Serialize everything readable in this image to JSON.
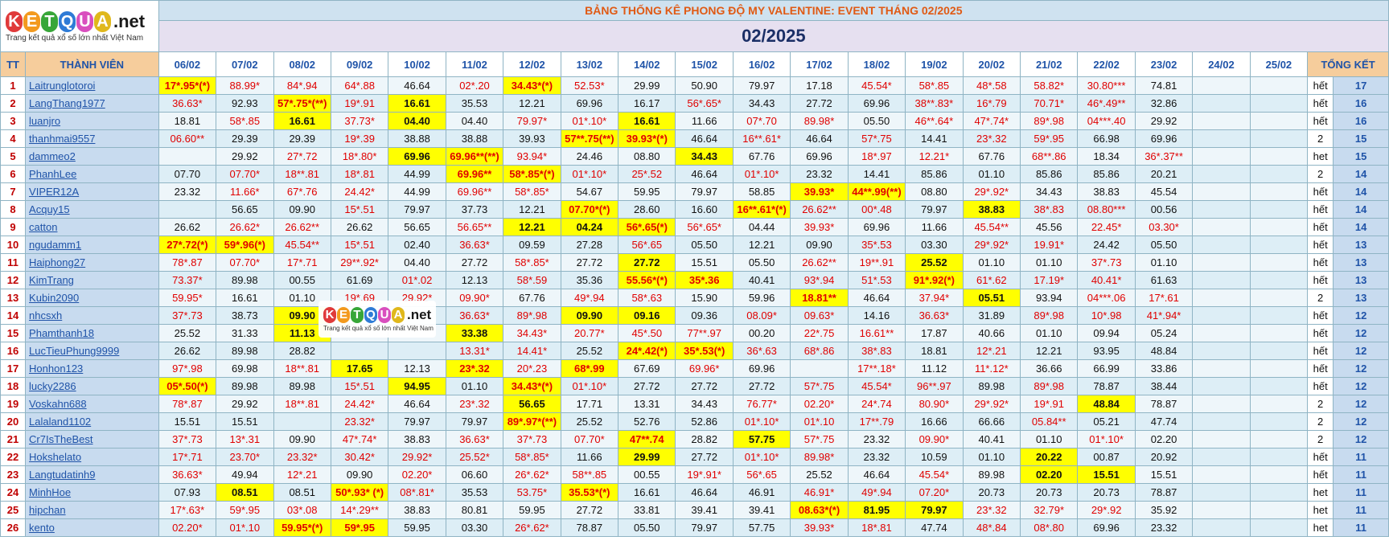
{
  "title": "BẢNG THỐNG KÊ PHONG ĐỘ MY VALENTINE: EVENT THÁNG 02/2025",
  "month": "02/2025",
  "logo": {
    "letters": [
      "K",
      "E",
      "T",
      "Q",
      "U",
      "A"
    ],
    "suffix": ".net",
    "tagline": "Trang kết quả xổ số lớn nhất Việt Nam",
    "colors": [
      "#e03a3a",
      "#f39a1e",
      "#37a638",
      "#2e7bd6",
      "#d94fbe",
      "#e0b81c"
    ]
  },
  "headers": {
    "tt": "TT",
    "member": "THÀNH VIÊN",
    "dates": [
      "06/02",
      "07/02",
      "08/02",
      "09/02",
      "10/02",
      "11/02",
      "12/02",
      "13/02",
      "14/02",
      "15/02",
      "16/02",
      "17/02",
      "18/02",
      "19/02",
      "20/02",
      "21/02",
      "22/02",
      "23/02",
      "24/02",
      "25/02"
    ],
    "total": "TỔNG KẾT"
  },
  "rows": [
    {
      "tt": "1",
      "name": "Laitrunglotoroi",
      "status": "hết",
      "total": "17",
      "cells": [
        "17*.95*(*)",
        "88.99*",
        "84*.94",
        "64*.88",
        "46.64",
        "02*.20",
        "34.43*(*)",
        "52.53*",
        "29.99",
        "50.90",
        "79.97",
        "17.18",
        "45.54*",
        "58*.85",
        "48*.58",
        "58.82*",
        "30.80***",
        "74.81",
        "",
        ""
      ]
    },
    {
      "tt": "2",
      "name": "LangThang1977",
      "status": "hết",
      "total": "16",
      "cells": [
        "36.63*",
        "92.93",
        "57*.75*(**)",
        "19*.91",
        "16.61",
        "35.53",
        "12.21",
        "69.96",
        "16.17",
        "56*.65*",
        "34.43",
        "27.72",
        "69.96",
        "38**.83*",
        "16*.79",
        "70.71*",
        "46*.49**",
        "32.86",
        "",
        ""
      ]
    },
    {
      "tt": "3",
      "name": "luanjro",
      "status": "hết",
      "total": "16",
      "cells": [
        "18.81",
        "58*.85",
        "16.61",
        "37.73*",
        "04.40",
        "04.40",
        "79.97*",
        "01*.10*",
        "16.61",
        "11.66",
        "07*.70",
        "89.98*",
        "05.50",
        "46**.64*",
        "47*.74*",
        "89*.98",
        "04***.40",
        "29.92",
        "",
        ""
      ]
    },
    {
      "tt": "4",
      "name": "thanhmai9557",
      "status": "2",
      "total": "15",
      "cells": [
        "06.60**",
        "29.39",
        "29.39",
        "19*.39",
        "38.88",
        "38.88",
        "39.93",
        "57**.75(**)",
        "39.93*(*)",
        "46.64",
        "16**.61*",
        "46.64",
        "57*.75",
        "14.41",
        "23*.32",
        "59*.95",
        "66.98",
        "69.96",
        "",
        ""
      ]
    },
    {
      "tt": "5",
      "name": "dammeo2",
      "status": "het",
      "total": "15",
      "cells": [
        "",
        "29.92",
        "27*.72",
        "18*.80*",
        "69.96",
        "69.96**(**)",
        "93.94*",
        "24.46",
        "08.80",
        "34.43",
        "67.76",
        "69.96",
        "18*.97",
        "12.21*",
        "67.76",
        "68**.86",
        "18.34",
        "36*.37**",
        "",
        ""
      ]
    },
    {
      "tt": "6",
      "name": "PhanhLee",
      "status": "2",
      "total": "14",
      "cells": [
        "07.70",
        "07.70*",
        "18**.81",
        "18*.81",
        "44.99",
        "69.96**",
        "58*.85*(*)",
        "01*.10*",
        "25*.52",
        "46.64",
        "01*.10*",
        "23.32",
        "14.41",
        "85.86",
        "01.10",
        "85.86",
        "85.86",
        "20.21",
        "",
        ""
      ]
    },
    {
      "tt": "7",
      "name": "VIPER12A",
      "status": "hết",
      "total": "14",
      "cells": [
        "23.32",
        "11.66*",
        "67*.76",
        "24.42*",
        "44.99",
        "69.96**",
        "58*.85*",
        "54.67",
        "59.95",
        "79.97",
        "58.85",
        "39.93*",
        "44**.99(**)",
        "08.80",
        "29*.92*",
        "34.43",
        "38.83",
        "45.54",
        "",
        ""
      ]
    },
    {
      "tt": "8",
      "name": "Acquy15",
      "status": "hết",
      "total": "14",
      "cells": [
        "",
        "56.65",
        "09.90",
        "15*.51",
        "79.97",
        "37.73",
        "12.21",
        "07.70*(*)",
        "28.60",
        "16.60",
        "16**.61*(*)",
        "26.62**",
        "00*.48",
        "79.97",
        "38.83",
        "38*.83",
        "08.80***",
        "00.56",
        "",
        ""
      ]
    },
    {
      "tt": "9",
      "name": "catton",
      "status": "hết",
      "total": "14",
      "cells": [
        "26.62",
        "26.62*",
        "26.62**",
        "26.62",
        "56.65",
        "56.65**",
        "12.21",
        "04.24",
        "56*.65(*)",
        "56*.65*",
        "04.44",
        "39.93*",
        "69.96",
        "11.66",
        "45.54**",
        "45.56",
        "22.45*",
        "03.30*",
        "",
        ""
      ]
    },
    {
      "tt": "10",
      "name": "ngudamm1",
      "status": "hết",
      "total": "13",
      "cells": [
        "27*.72(*)",
        "59*.96(*)",
        "45.54**",
        "15*.51",
        "02.40",
        "36.63*",
        "09.59",
        "27.28",
        "56*.65",
        "05.50",
        "12.21",
        "09.90",
        "35*.53",
        "03.30",
        "29*.92*",
        "19.91*",
        "24.42",
        "05.50",
        "",
        ""
      ]
    },
    {
      "tt": "11",
      "name": "Haiphong27",
      "status": "hết",
      "total": "13",
      "cells": [
        "78*.87",
        "07.70*",
        "17*.71",
        "29**.92*",
        "04.40",
        "27.72",
        "58*.85*",
        "27.72",
        "27.72",
        "15.51",
        "05.50",
        "26.62**",
        "19**.91",
        "25.52",
        "01.10",
        "01.10",
        "37*.73",
        "01.10",
        "",
        ""
      ]
    },
    {
      "tt": "12",
      "name": "KimTrang",
      "status": "hết",
      "total": "13",
      "cells": [
        "73.37*",
        "89.98",
        "00.55",
        "61.69",
        "01*.02",
        "12.13",
        "58*.59",
        "35.36",
        "55.56*(*)",
        "35*.36",
        "40.41",
        "93*.94",
        "51*.53",
        "91*.92(*)",
        "61*.62",
        "17.19*",
        "40.41*",
        "61.63",
        "",
        ""
      ]
    },
    {
      "tt": "13",
      "name": "Kubin2090",
      "status": "2",
      "total": "13",
      "cells": [
        "59.95*",
        "16.61",
        "01.10",
        "19*.69",
        "29.92*",
        "09.90*",
        "67.76",
        "49*.94",
        "58*.63",
        "15.90",
        "59.96",
        "18.81**",
        "46.64",
        "37.94*",
        "05.51",
        "93.94",
        "04***.06",
        "17*.61",
        "",
        ""
      ]
    },
    {
      "tt": "14",
      "name": "nhcsxh",
      "status": "hết",
      "total": "12",
      "cells": [
        "37*.73",
        "38.73",
        "09.90",
        "",
        "",
        "36.63*",
        "89*.98",
        "09.90",
        "09.16",
        "09.36",
        "08.09*",
        "09.63*",
        "14.16",
        "36.63*",
        "31.89",
        "89*.98",
        "10*.98",
        "41*.94*",
        "",
        ""
      ]
    },
    {
      "tt": "15",
      "name": "Phamthanh18",
      "status": "hết",
      "total": "12",
      "cells": [
        "25.52",
        "31.33",
        "11.13",
        "",
        "",
        "33.38",
        "34.43*",
        "20.77*",
        "45*.50",
        "77**.97",
        "00.20",
        "22*.75",
        "16.61**",
        "17.87",
        "40.66",
        "01.10",
        "09.94",
        "05.24",
        "",
        ""
      ]
    },
    {
      "tt": "16",
      "name": "LucTieuPhung9999",
      "status": "hết",
      "total": "12",
      "cells": [
        "26.62",
        "89.98",
        "28.82",
        "",
        "",
        "13.31*",
        "14.41*",
        "25.52",
        "24*.42(*)",
        "35*.53(*)",
        "36*.63",
        "68*.86",
        "38*.83",
        "18.81",
        "12*.21",
        "12.21",
        "93.95",
        "48.84",
        "",
        ""
      ]
    },
    {
      "tt": "17",
      "name": "Honhon123",
      "status": "hết",
      "total": "12",
      "cells": [
        "97*.98",
        "69.98",
        "18**.81",
        "17.65",
        "12.13",
        "23*.32",
        "20*.23",
        "68*.99",
        "67.69",
        "69.96*",
        "69.96",
        "",
        "17**.18*",
        "11.12",
        "11*.12*",
        "36.66",
        "66.99",
        "33.86",
        "",
        ""
      ]
    },
    {
      "tt": "18",
      "name": "lucky2286",
      "status": "hết",
      "total": "12",
      "cells": [
        "05*.50(*)",
        "89.98",
        "89.98",
        "15*.51",
        "94.95",
        "01.10",
        "34.43*(*)",
        "01*.10*",
        "27.72",
        "27.72",
        "27.72",
        "57*.75",
        "45.54*",
        "96**.97",
        "89.98",
        "89*.98",
        "78.87",
        "38.44",
        "",
        ""
      ]
    },
    {
      "tt": "19",
      "name": "Voskahn688",
      "status": "2",
      "total": "12",
      "cells": [
        "78*.87",
        "29.92",
        "18**.81",
        "24.42*",
        "46.64",
        "23*.32",
        "56.65",
        "17.71",
        "13.31",
        "34.43",
        "76.77*",
        "02.20*",
        "24*.74",
        "80.90*",
        "29*.92*",
        "19*.91",
        "48.84",
        "78.87",
        "",
        ""
      ]
    },
    {
      "tt": "20",
      "name": "Lalaland1102",
      "status": "2",
      "total": "12",
      "cells": [
        "15.51",
        "15.51",
        "",
        "23.32*",
        "79.97",
        "79.97",
        "89*.97*(**)",
        "25.52",
        "52.76",
        "52.86",
        "01*.10*",
        "01*.10",
        "17**.79",
        "16.66",
        "66.66",
        "05.84**",
        "05.21",
        "47.74",
        "",
        ""
      ]
    },
    {
      "tt": "21",
      "name": "Cr7IsTheBest",
      "status": "2",
      "total": "12",
      "cells": [
        "37*.73",
        "13*.31",
        "09.90",
        "47*.74*",
        "38.83",
        "36.63*",
        "37*.73",
        "07.70*",
        "47**.74",
        "28.82",
        "57.75",
        "57*.75",
        "23.32",
        "09.90*",
        "40.41",
        "01.10",
        "01*.10*",
        "02.20",
        "",
        ""
      ]
    },
    {
      "tt": "22",
      "name": "Hokshelato",
      "status": "hết",
      "total": "11",
      "cells": [
        "17*.71",
        "23.70*",
        "23.32*",
        "30.42*",
        "29.92*",
        "25.52*",
        "58*.85*",
        "11.66",
        "29.99",
        "27.72",
        "01*.10*",
        "89.98*",
        "23.32",
        "10.59",
        "01.10",
        "20.22",
        "00.87",
        "20.92",
        "",
        ""
      ]
    },
    {
      "tt": "23",
      "name": "Langtudatinh9",
      "status": "hết",
      "total": "11",
      "cells": [
        "36.63*",
        "49.94",
        "12*.21",
        "09.90",
        "02.20*",
        "06.60",
        "26*.62*",
        "58**.85",
        "00.55",
        "19*.91*",
        "56*.65",
        "25.52",
        "46.64",
        "45.54*",
        "89.98",
        "02.20",
        "15.51",
        "15.51",
        "",
        ""
      ]
    },
    {
      "tt": "24",
      "name": "MinhHoe",
      "status": "het",
      "total": "11",
      "cells": [
        "07.93",
        "08.51",
        "08.51",
        "50*.93* (*)",
        "08*.81*",
        "35.53",
        "53.75*",
        "35.53*(*)",
        "16.61",
        "46.64",
        "46.91",
        "46.91*",
        "49*.94",
        "07.20*",
        "20.73",
        "20.73",
        "20.73",
        "78.87",
        "",
        ""
      ]
    },
    {
      "tt": "25",
      "name": "hipchan",
      "status": "het",
      "total": "11",
      "cells": [
        "17*.63*",
        "59*.95",
        "03*.08",
        "14*.29**",
        "38.83",
        "80.81",
        "59.95",
        "27.72",
        "33.81",
        "39.41",
        "39.41",
        "08.63*(*)",
        "81.95",
        "79.97",
        "23*.32",
        "32.79*",
        "29*.92",
        "35.92",
        "",
        ""
      ]
    },
    {
      "tt": "26",
      "name": "kento",
      "status": "het",
      "total": "11",
      "cells": [
        "02.20*",
        "01*.10",
        "59.95*(*)",
        "59*.95",
        "59.95",
        "03.30",
        "26*.62*",
        "78.87",
        "05.50",
        "79.97",
        "57.75",
        "39.93*",
        "18*.81",
        "47.74",
        "48*.84",
        "08*.80",
        "69.96",
        "23.32",
        "",
        ""
      ]
    }
  ],
  "highlights": [
    [
      0,
      0
    ],
    [
      0,
      6
    ],
    [
      1,
      2
    ],
    [
      1,
      4
    ],
    [
      2,
      2
    ],
    [
      2,
      4
    ],
    [
      2,
      8
    ],
    [
      3,
      7
    ],
    [
      3,
      8
    ],
    [
      4,
      4
    ],
    [
      4,
      5
    ],
    [
      4,
      9
    ],
    [
      5,
      5
    ],
    [
      5,
      6
    ],
    [
      6,
      11
    ],
    [
      6,
      12
    ],
    [
      7,
      7
    ],
    [
      7,
      10
    ],
    [
      7,
      14
    ],
    [
      8,
      6
    ],
    [
      8,
      7
    ],
    [
      8,
      8
    ],
    [
      9,
      0
    ],
    [
      9,
      1
    ],
    [
      10,
      8
    ],
    [
      10,
      13
    ],
    [
      11,
      8
    ],
    [
      11,
      9
    ],
    [
      11,
      13
    ],
    [
      12,
      11
    ],
    [
      12,
      14
    ],
    [
      13,
      2
    ],
    [
      13,
      7
    ],
    [
      13,
      8
    ],
    [
      14,
      2
    ],
    [
      14,
      5
    ],
    [
      15,
      8
    ],
    [
      15,
      9
    ],
    [
      16,
      3
    ],
    [
      16,
      5
    ],
    [
      16,
      7
    ],
    [
      17,
      0
    ],
    [
      17,
      4
    ],
    [
      17,
      6
    ],
    [
      18,
      6
    ],
    [
      18,
      16
    ],
    [
      19,
      6
    ],
    [
      20,
      8
    ],
    [
      20,
      10
    ],
    [
      21,
      8
    ],
    [
      21,
      15
    ],
    [
      22,
      15
    ],
    [
      22,
      16
    ],
    [
      23,
      1
    ],
    [
      23,
      3
    ],
    [
      23,
      7
    ],
    [
      24,
      11
    ],
    [
      24,
      12
    ],
    [
      24,
      13
    ],
    [
      25,
      2
    ],
    [
      25,
      3
    ]
  ]
}
